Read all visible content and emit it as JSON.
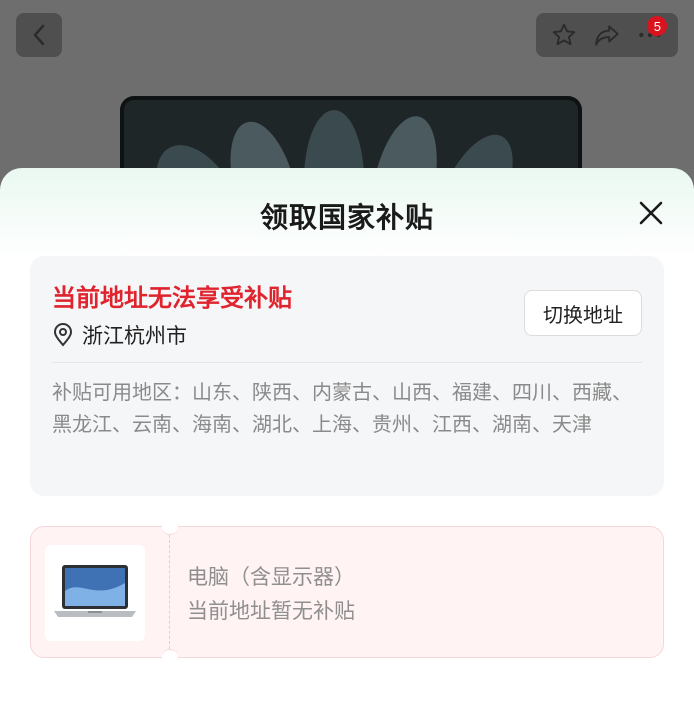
{
  "header": {
    "cart_badge": "5",
    "icons": [
      "back-icon",
      "star-icon",
      "share-icon",
      "more-icon"
    ]
  },
  "sheet": {
    "title": "领取国家补贴",
    "close_icon": "close-icon"
  },
  "address_card": {
    "warning": "当前地址无法享受补贴",
    "location": "浙江杭州市",
    "switch_label": "切换地址",
    "regions_text": "补贴可用地区：山东、陕西、内蒙古、山西、福建、四川、西藏、黑龙江、云南、海南、湖北、上海、贵州、江西、湖南、天津"
  },
  "product": {
    "name": "电脑（含显示器）",
    "status": "当前地址暂无补贴"
  },
  "colors": {
    "warning": "#e0242e",
    "badge": "#d9141f",
    "sheet_top_tint": "#eaf8f1",
    "product_bg": "#fff3f4"
  }
}
